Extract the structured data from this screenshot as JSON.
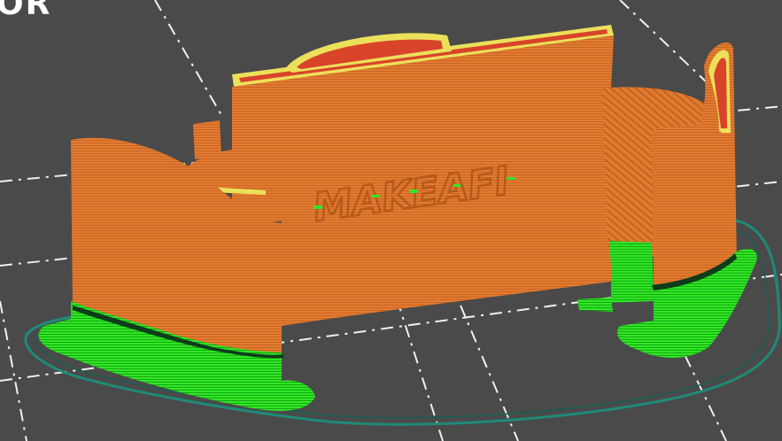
{
  "app": {
    "view": "preview",
    "corner_label": "OR"
  },
  "colors": {
    "background": "#4a4a4a",
    "bed_grid": "#f0f0f0",
    "perimeter": "#e07a2f",
    "perimeter_dark": "#c46322",
    "support": "#25e21c",
    "support_dark": "#1aa816",
    "top_infill": "#d8442a",
    "solid_edge": "#ece05a",
    "skirt": "#1f8a78"
  },
  "model": {
    "embossed_text": "MAKEAFI"
  }
}
